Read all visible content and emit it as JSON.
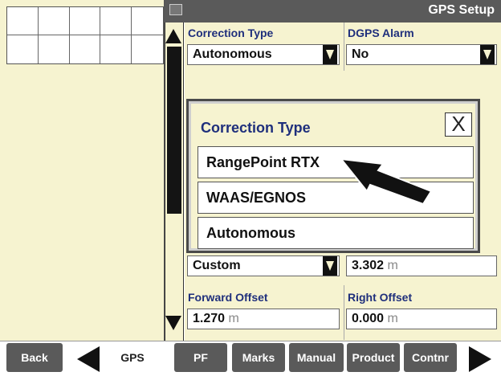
{
  "window": {
    "title": "GPS Setup"
  },
  "correction_type": {
    "label": "Correction Type",
    "value": "Autonomous"
  },
  "dgps_alarm": {
    "label": "DGPS Alarm",
    "value": "No"
  },
  "mode_field": {
    "value": "Custom"
  },
  "height_field": {
    "value": "3.302",
    "unit": "m"
  },
  "forward_offset": {
    "label": "Forward Offset",
    "value": "1.270",
    "unit": "m"
  },
  "right_offset": {
    "label": "Right Offset",
    "value": "0.000",
    "unit": "m"
  },
  "popup": {
    "title": "Correction Type",
    "close_label": "X",
    "options": [
      "RangePoint RTX",
      "WAAS/EGNOS",
      "Autonomous"
    ]
  },
  "bottom_bar": {
    "back_label": "Back",
    "gps_label": "GPS",
    "tabs": [
      "PF",
      "Marks",
      "Manual",
      "Product",
      "Contnr"
    ]
  },
  "colors": {
    "panel": "#f6f3d0",
    "label": "#1f2f7c",
    "button": "#5a5a5a"
  }
}
